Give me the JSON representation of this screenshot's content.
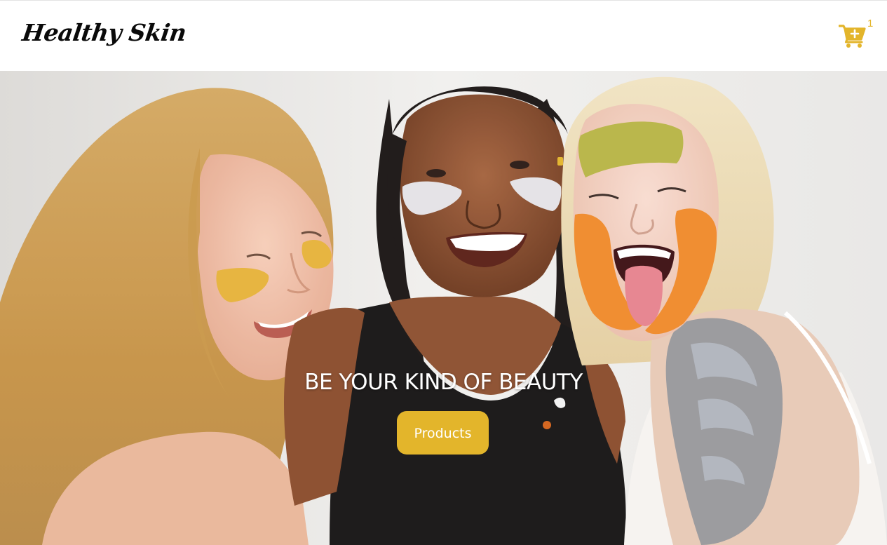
{
  "brand": {
    "logo_text": "Healthy Skin"
  },
  "header": {
    "cart_icon": "shopping-cart-plus-icon",
    "cart_count": "1"
  },
  "hero": {
    "headline": "BE YOUR KIND OF BEAUTY",
    "cta_label": "Products",
    "image_subject": "hero-photo-three-women-face-masks"
  },
  "colors": {
    "accent": "#e3b52b",
    "header_bg": "#ffffff",
    "logo_text": "#0a0a0a",
    "hero_text": "#ffffff"
  }
}
